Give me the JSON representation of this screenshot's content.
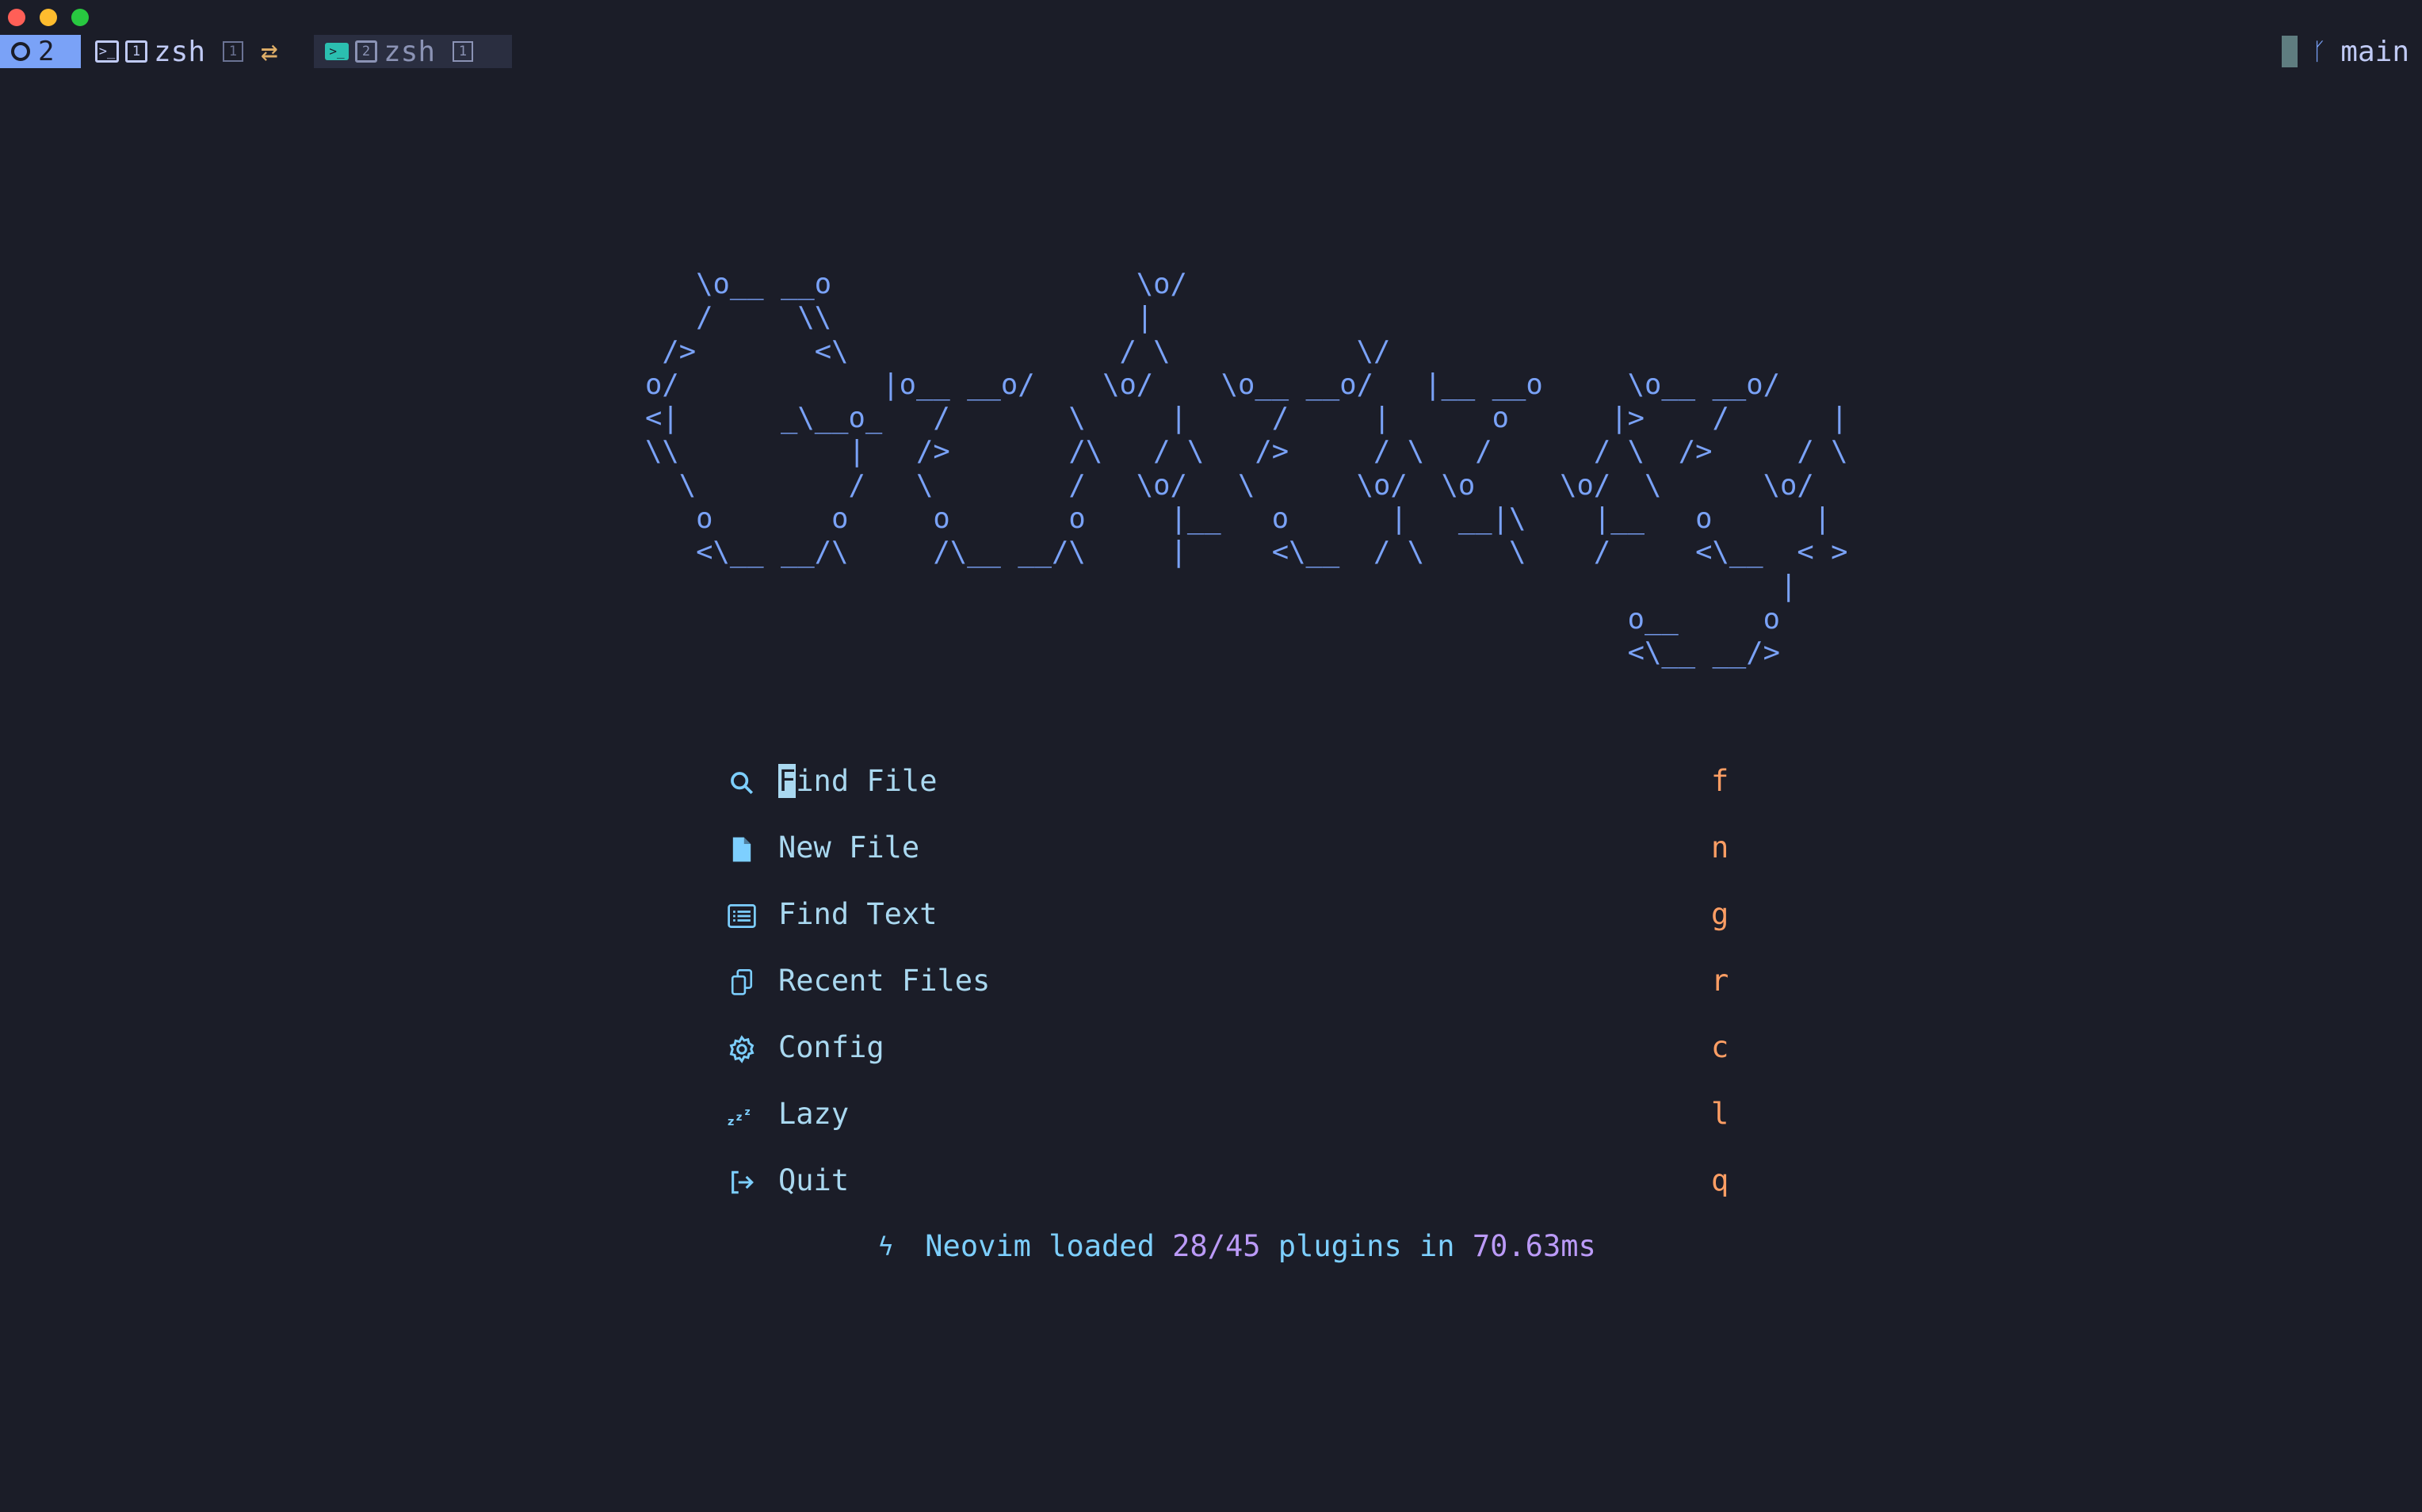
{
  "window": {
    "traffic_lights": {
      "close": "#ff5f57",
      "minimize": "#febc2e",
      "maximize": "#28c840"
    }
  },
  "tabbar": {
    "session_number": "2",
    "tab1": {
      "label": "zsh",
      "pane_index": "1",
      "window_index": "1",
      "icon": "terminal-icon"
    },
    "tab2": {
      "label": "zsh",
      "pane_index": "2",
      "window_index": "1",
      "icon": "terminal-icon"
    },
    "branch": "main",
    "colors": {
      "accent": "#7aa2f7",
      "sync": "#e0af68"
    }
  },
  "dashboard": {
    "logo_lines": [
      "   \\o__ __o                  \\o/",
      "   /     \\\\                  |",
      " />       <\\                / \\           \\/",
      "o/            |o__ __o/    \\o/    \\o__ __o/   |__ __o     \\o__ __o/",
      "<|      _\\__o_   /       \\     |     /     |      o      |>    /      |",
      "\\\\          |   />       /\\   / \\   />     / \\   /      / \\  />     / \\",
      "  \\         /   \\        /   \\o/   \\      \\o/  \\o     \\o/  \\      \\o/",
      "   o       o     o       o     |__   o      |   __|\\    |__   o      |",
      "   <\\__ __/\\     /\\__ __/\\     |     <\\__  / \\     \\    /     <\\__  < >",
      "                                                                   |",
      "                                                          o__     o",
      "                                                          <\\__ __/>"
    ],
    "items": [
      {
        "icon": "search-icon",
        "label": "Find File",
        "key": "f"
      },
      {
        "icon": "file-icon",
        "label": "New File",
        "key": "n"
      },
      {
        "icon": "list-icon",
        "label": "Find Text",
        "key": "g"
      },
      {
        "icon": "copy-icon",
        "label": "Recent Files",
        "key": "r"
      },
      {
        "icon": "gear-icon",
        "label": "Config",
        "key": "c"
      },
      {
        "icon": "sleep-icon",
        "label": "Lazy",
        "key": "l"
      },
      {
        "icon": "exit-icon",
        "label": "Quit",
        "key": "q"
      }
    ],
    "footer": {
      "prefix": "Neovim loaded ",
      "plugins": "28/45",
      "middle": " plugins in ",
      "time": "70.63ms"
    },
    "colors": {
      "label": "#a9d8f0",
      "key": "#ff9e64",
      "logo": "#7aa2f7",
      "number": "#bb9af7"
    }
  }
}
